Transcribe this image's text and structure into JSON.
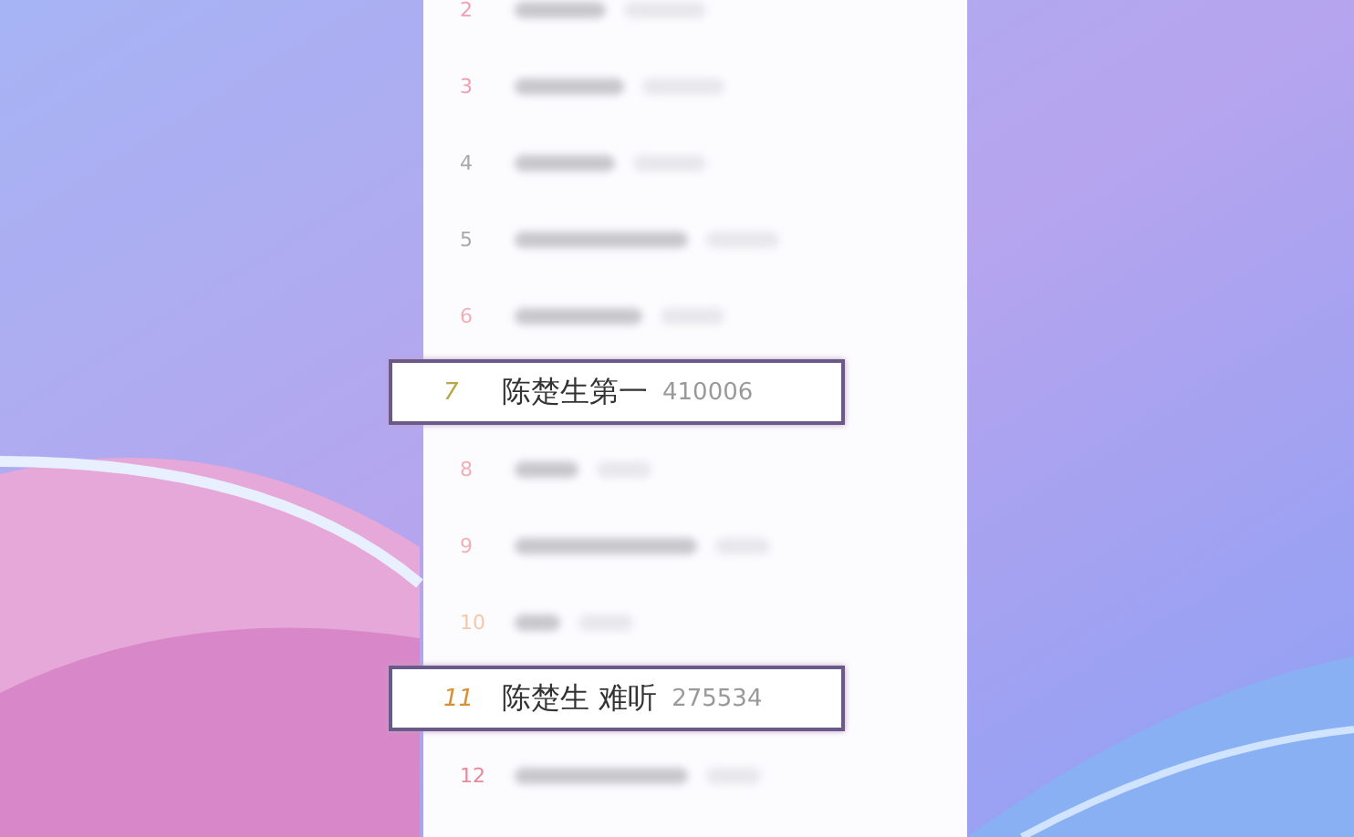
{
  "list": [
    {
      "rank": "2",
      "kind": "blurred",
      "color": "#f0a0b0"
    },
    {
      "rank": "3",
      "kind": "blurred",
      "color": "#f0a0b0"
    },
    {
      "rank": "4",
      "kind": "blurred",
      "color": "#a8a8a8"
    },
    {
      "rank": "5",
      "kind": "blurred",
      "color": "#a8a8a8"
    },
    {
      "rank": "6",
      "kind": "blurred",
      "color": "#f0b0b8"
    },
    {
      "rank": "7",
      "kind": "highlighted",
      "color": "#b8a848",
      "title": "陈楚生第一",
      "count": "410006"
    },
    {
      "rank": "8",
      "kind": "blurred",
      "color": "#f0b0b8"
    },
    {
      "rank": "9",
      "kind": "blurred",
      "color": "#f0b0b8"
    },
    {
      "rank": "10",
      "kind": "blurred",
      "color": "#f4c8a8"
    },
    {
      "rank": "11",
      "kind": "highlighted",
      "color": "#d89038",
      "title": "陈楚生 难听",
      "count": "275534"
    },
    {
      "rank": "12",
      "kind": "blurred",
      "color": "#e88898"
    }
  ]
}
